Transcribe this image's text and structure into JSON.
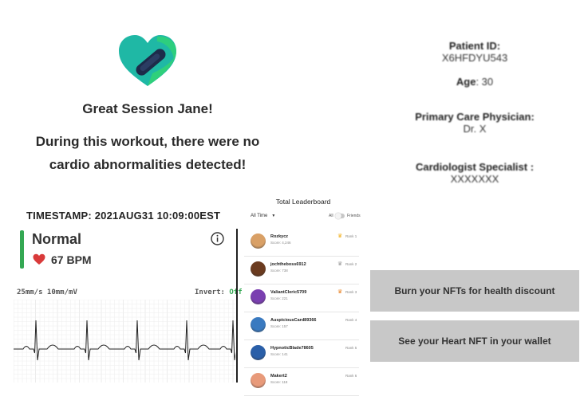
{
  "session": {
    "title": "Great Session Jane!",
    "message": "During this workout, there were no cardio abnormalities detected!"
  },
  "patient": {
    "id_label": "Patient ID:",
    "id_value": "X6HFDYU543",
    "age_label": "Age",
    "age_value": ": 30",
    "pcp_label": "Primary Care Physician:",
    "pcp_value": "Dr. X",
    "cardio_label": "Cardiologist Specialist :",
    "cardio_value": "XXXXXXX"
  },
  "ecg": {
    "timestamp": "TIMESTAMP: 2021AUG31 10:09:00EST",
    "status": "Normal",
    "bpm": "67 BPM",
    "scale_label": "25mm/s 10mm/mV",
    "invert_label": "Invert:",
    "invert_value": "Off",
    "status_color": "#34a853",
    "heart_color": "#d93a3a"
  },
  "leaderboard": {
    "title": "Total Leaderboard",
    "filter": "All Time",
    "toggle_left": "All",
    "toggle_right": "Friends",
    "rows": [
      {
        "name": "Rozkycz",
        "score": "Score: 4,246",
        "rank": "Rank 1",
        "crown": "gold",
        "avatar": "#d9a066"
      },
      {
        "name": "jochtheboss6912",
        "score": "Score: 738",
        "rank": "Rank 2",
        "crown": "silver",
        "avatar": "#6b3b1f"
      },
      {
        "name": "ValiantCleric5709",
        "score": "Score: 221",
        "rank": "Rank 3",
        "crown": "bronze",
        "avatar": "#7a3fb0"
      },
      {
        "name": "AuspiciousCard89366",
        "score": "Score: 157",
        "rank": "Rank 4",
        "crown": "",
        "avatar": "#3a7ac0"
      },
      {
        "name": "HypnoticBlade78605",
        "score": "Score: 141",
        "rank": "Rank 5",
        "crown": "",
        "avatar": "#2a5fa8"
      },
      {
        "name": "Makert2",
        "score": "Score: 118",
        "rank": "Rank 6",
        "crown": "",
        "avatar": "#e89a7a"
      }
    ]
  },
  "actions": {
    "burn_label": "Burn your NFTs for health discount",
    "heart_label": "See your Heart NFT in your wallet"
  },
  "colors": {
    "logo_primary": "#1fb8a5",
    "logo_secondary": "#2fd07a",
    "logo_band": "#1d2b4a",
    "button_bg": "#c8c8c8"
  }
}
